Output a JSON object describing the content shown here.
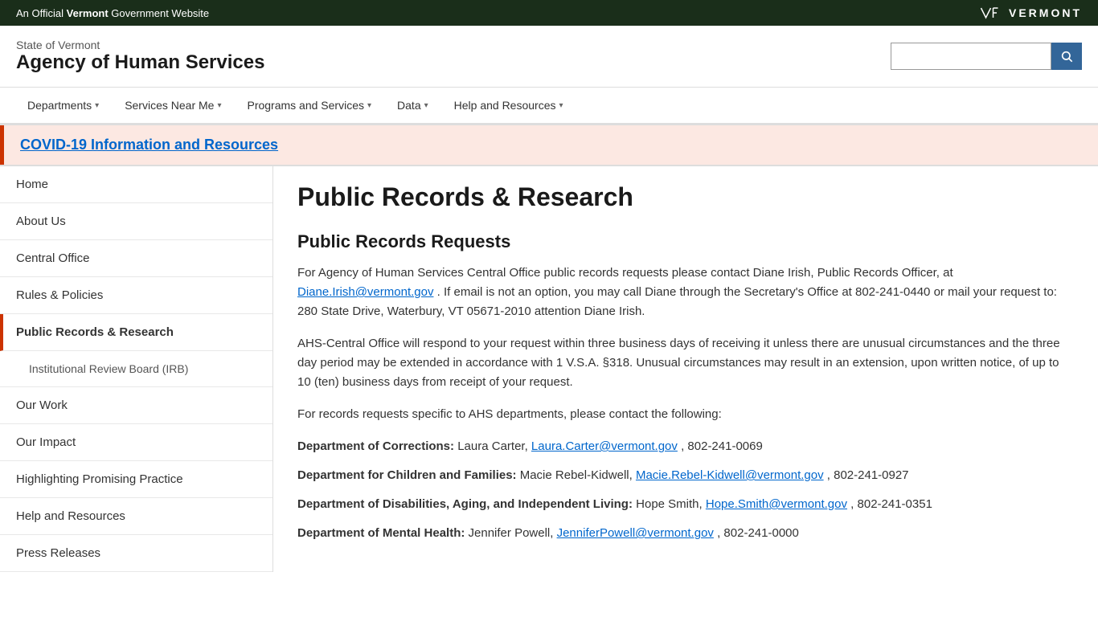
{
  "topbar": {
    "official_text": "An Official",
    "state_name": "Vermont",
    "gov_text": "Government Website",
    "vt_logo_text": "VERMONT"
  },
  "header": {
    "state_label": "State of Vermont",
    "agency_name": "Agency of Human Services",
    "search_placeholder": "",
    "search_button_icon": "🔍"
  },
  "nav": {
    "items": [
      {
        "label": "Departments",
        "has_dropdown": true
      },
      {
        "label": "Services Near Me",
        "has_dropdown": true
      },
      {
        "label": "Programs and Services",
        "has_dropdown": true
      },
      {
        "label": "Data",
        "has_dropdown": true
      },
      {
        "label": "Help and Resources",
        "has_dropdown": true
      }
    ]
  },
  "covid_banner": {
    "link_text": "COVID-19 Information and Resources"
  },
  "sidebar": {
    "items": [
      {
        "label": "Home",
        "active": false,
        "sub": false
      },
      {
        "label": "About Us",
        "active": false,
        "sub": false
      },
      {
        "label": "Central Office",
        "active": false,
        "sub": false
      },
      {
        "label": "Rules & Policies",
        "active": false,
        "sub": false
      },
      {
        "label": "Public Records & Research",
        "active": true,
        "sub": false
      },
      {
        "label": "Institutional Review Board (IRB)",
        "active": false,
        "sub": true
      },
      {
        "label": "Our Work",
        "active": false,
        "sub": false
      },
      {
        "label": "Our Impact",
        "active": false,
        "sub": false
      },
      {
        "label": "Highlighting Promising Practice",
        "active": false,
        "sub": false
      },
      {
        "label": "Help and Resources",
        "active": false,
        "sub": false
      },
      {
        "label": "Press Releases",
        "active": false,
        "sub": false
      }
    ]
  },
  "content": {
    "page_title": "Public Records & Research",
    "section1_heading": "Public Records Requests",
    "para1": "For Agency of Human Services Central Office public records requests please contact Diane Irish, Public Records Officer, at",
    "email1": "Diane.Irish@vermont.gov",
    "para1_cont": ". If email is not an option, you may call Diane through the Secretary's Office at 802-241-0440 or mail your request to: 280 State Drive, Waterbury, VT 05671-2010 attention Diane Irish.",
    "para2": "AHS-Central Office will respond to your request within three business days of receiving it unless there are unusual circumstances and the three day period may be extended in accordance with 1 V.S.A. §318.  Unusual circumstances may result in an extension, upon written notice, of up to 10 (ten) business days from receipt of your request.",
    "para3": "For records requests specific to AHS departments, please contact the following:",
    "departments": [
      {
        "name": "Department of Corrections:",
        "contact": "Laura Carter,",
        "email": "Laura.Carter@vermont.gov",
        "phone": ", 802-241-0069"
      },
      {
        "name": "Department for Children and Families:",
        "contact": "Macie Rebel-Kidwell,",
        "email": "Macie.Rebel-Kidwell@vermont.gov",
        "phone": ", 802-241-0927"
      },
      {
        "name": "Department of Disabilities, Aging, and Independent Living:",
        "contact": "Hope Smith,",
        "email": "Hope.Smith@vermont.gov",
        "phone": ", 802-241-0351"
      },
      {
        "name": "Department of Mental Health:",
        "contact": "Jennifer Powell,",
        "email": "JenniferPowell@vermont.gov",
        "phone": ", 802-241-0000"
      }
    ]
  }
}
